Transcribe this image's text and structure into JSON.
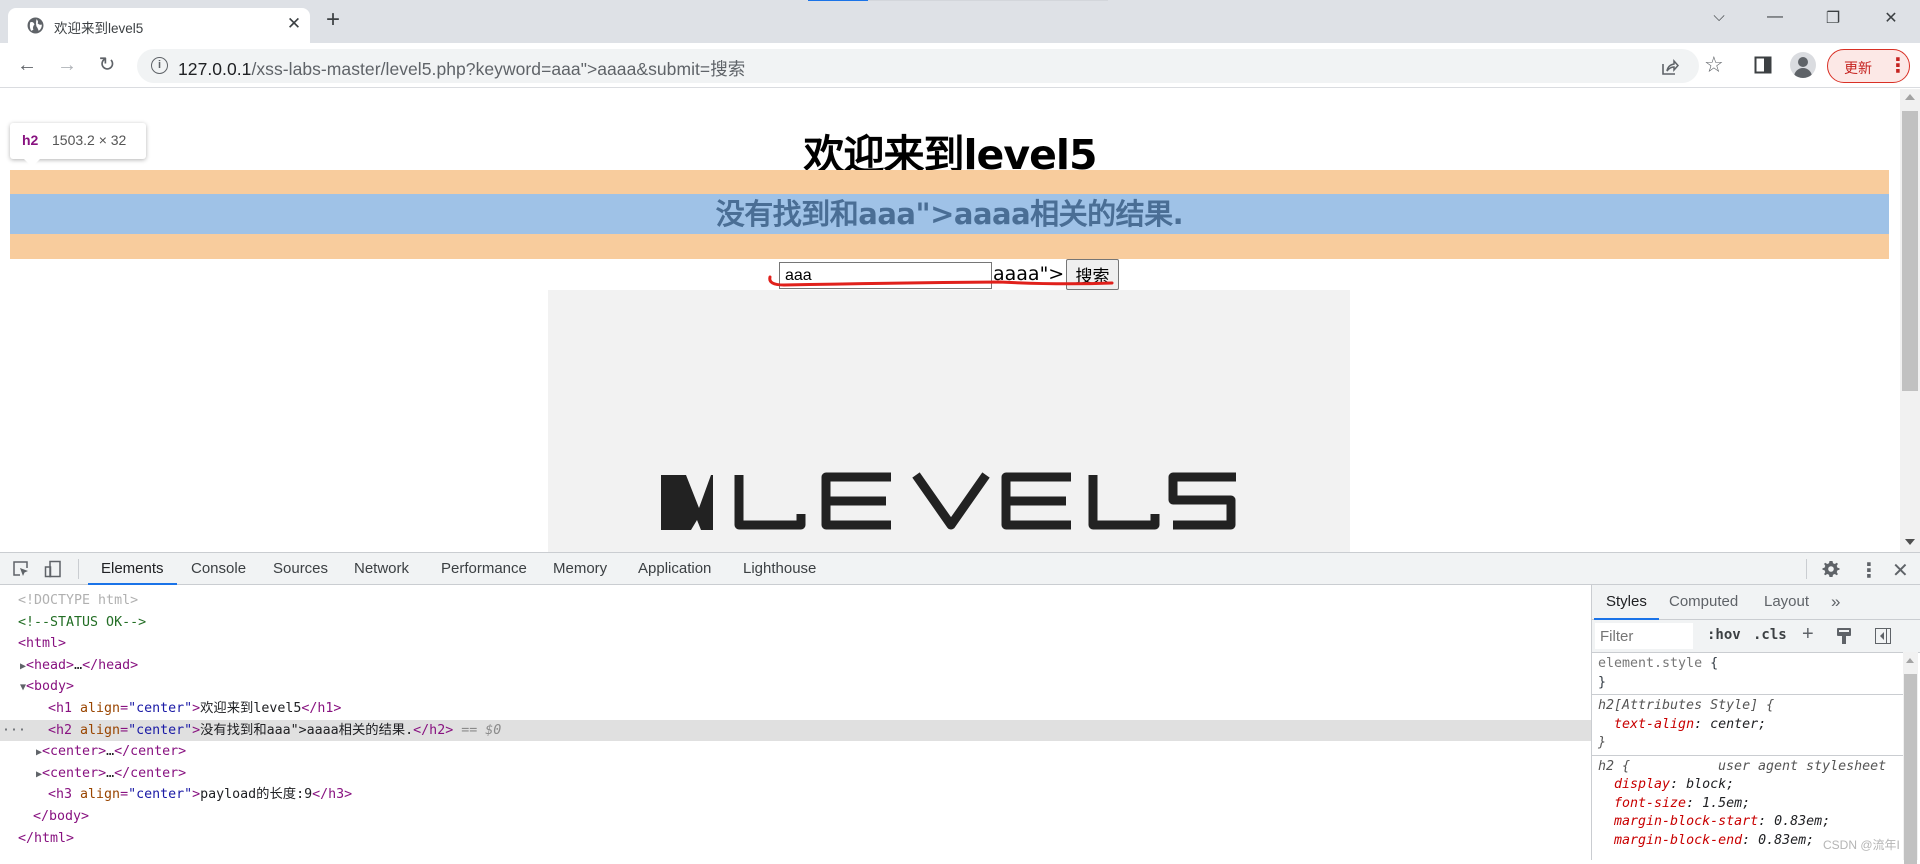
{
  "browser": {
    "tab": {
      "title": "欢迎来到level5",
      "favicon": "globe-icon",
      "close_glyph": "✕"
    },
    "new_tab_glyph": "+",
    "window_controls": {
      "tab_search": "⌵",
      "minimize": "—",
      "restore": "❐",
      "close": "✕"
    },
    "nav": {
      "back": "←",
      "forward": "→",
      "reload": "↻"
    },
    "address": {
      "info_glyph": "i",
      "host": "127.0.0.1",
      "path": "/xss-labs-master/level5.php?keyword=aaa\">aaaa&submit=搜索"
    },
    "toolbar_icons": {
      "share": "share-icon",
      "bookmark": "☆",
      "sidepanel": "sidepanel-icon"
    },
    "update_button": {
      "label": "更新",
      "menu_glyph": "⋮"
    },
    "accent": "#1a73e8",
    "update_color": "#d93025"
  },
  "page": {
    "h1": "欢迎来到level5",
    "h2": "没有找到和aaa\">aaaa相关的结果.",
    "inspect_tooltip": {
      "tag": "h2",
      "dimensions": "1503.2 × 32"
    },
    "search": {
      "input_value": "aaa",
      "trailing_text": "aaaa\">",
      "button_label": "搜索"
    },
    "image_alt": "LEVEL5",
    "highlight_colors": {
      "margin": "#f8cc9d",
      "content": "#9fc2e7"
    },
    "annotation_color": "#e0201b"
  },
  "devtools": {
    "tabs": [
      "Elements",
      "Console",
      "Sources",
      "Network",
      "Performance",
      "Memory",
      "Application",
      "Lighthouse"
    ],
    "active_tab": "Elements",
    "dom": {
      "doctype": "<!DOCTYPE html>",
      "comment": "<!--STATUS OK-->",
      "html_open": "<html>",
      "head": {
        "open": "<head>",
        "ellipsis": "…",
        "close": "</head>"
      },
      "body_open": "<body>",
      "h1": {
        "open": "<h1 ",
        "attr": "align",
        "eq": "=",
        "val": "\"center\"",
        "gt": ">",
        "text": "欢迎来到level5",
        "close": "</h1>"
      },
      "h2": {
        "open": "<h2 ",
        "attr": "align",
        "eq": "=",
        "val": "\"center\"",
        "gt": ">",
        "text": "没有找到和aaa\">aaaa相关的结果.",
        "close": "</h2>",
        "marker": " == $0",
        "gutter": "···"
      },
      "center1": {
        "open": "<center>",
        "ellipsis": "…",
        "close": "</center>"
      },
      "center2": {
        "open": "<center>",
        "ellipsis": "…",
        "close": "</center>"
      },
      "h3": {
        "open": "<h3 ",
        "attr": "align",
        "eq": "=",
        "val": "\"center\"",
        "gt": ">",
        "text": "payload的长度:9",
        "close": "</h3>"
      },
      "body_close": "</body>",
      "html_close": "</html>"
    },
    "styles": {
      "tabs": [
        "Styles",
        "Computed",
        "Layout",
        "»"
      ],
      "active_tab": "Styles",
      "filter_placeholder": "Filter",
      "hov": ":hov",
      "cls": ".cls",
      "add": "+",
      "rules": {
        "element_style": {
          "selector": "element.style",
          "open": " {",
          "close": "}"
        },
        "attr_style": {
          "selector": "h2[Attributes Style]",
          "open": " {",
          "prop": "text-align",
          "value": "center",
          "close": "}"
        },
        "ua": {
          "selector": "h2",
          "open": " {",
          "source": "user agent stylesheet",
          "props": [
            {
              "name": "display",
              "value": "block"
            },
            {
              "name": "font-size",
              "value": "1.5em"
            },
            {
              "name": "margin-block-start",
              "value": "0.83em"
            },
            {
              "name": "margin-block-end",
              "value": "0.83em"
            }
          ]
        }
      }
    }
  },
  "watermark": "CSDN @流年I"
}
